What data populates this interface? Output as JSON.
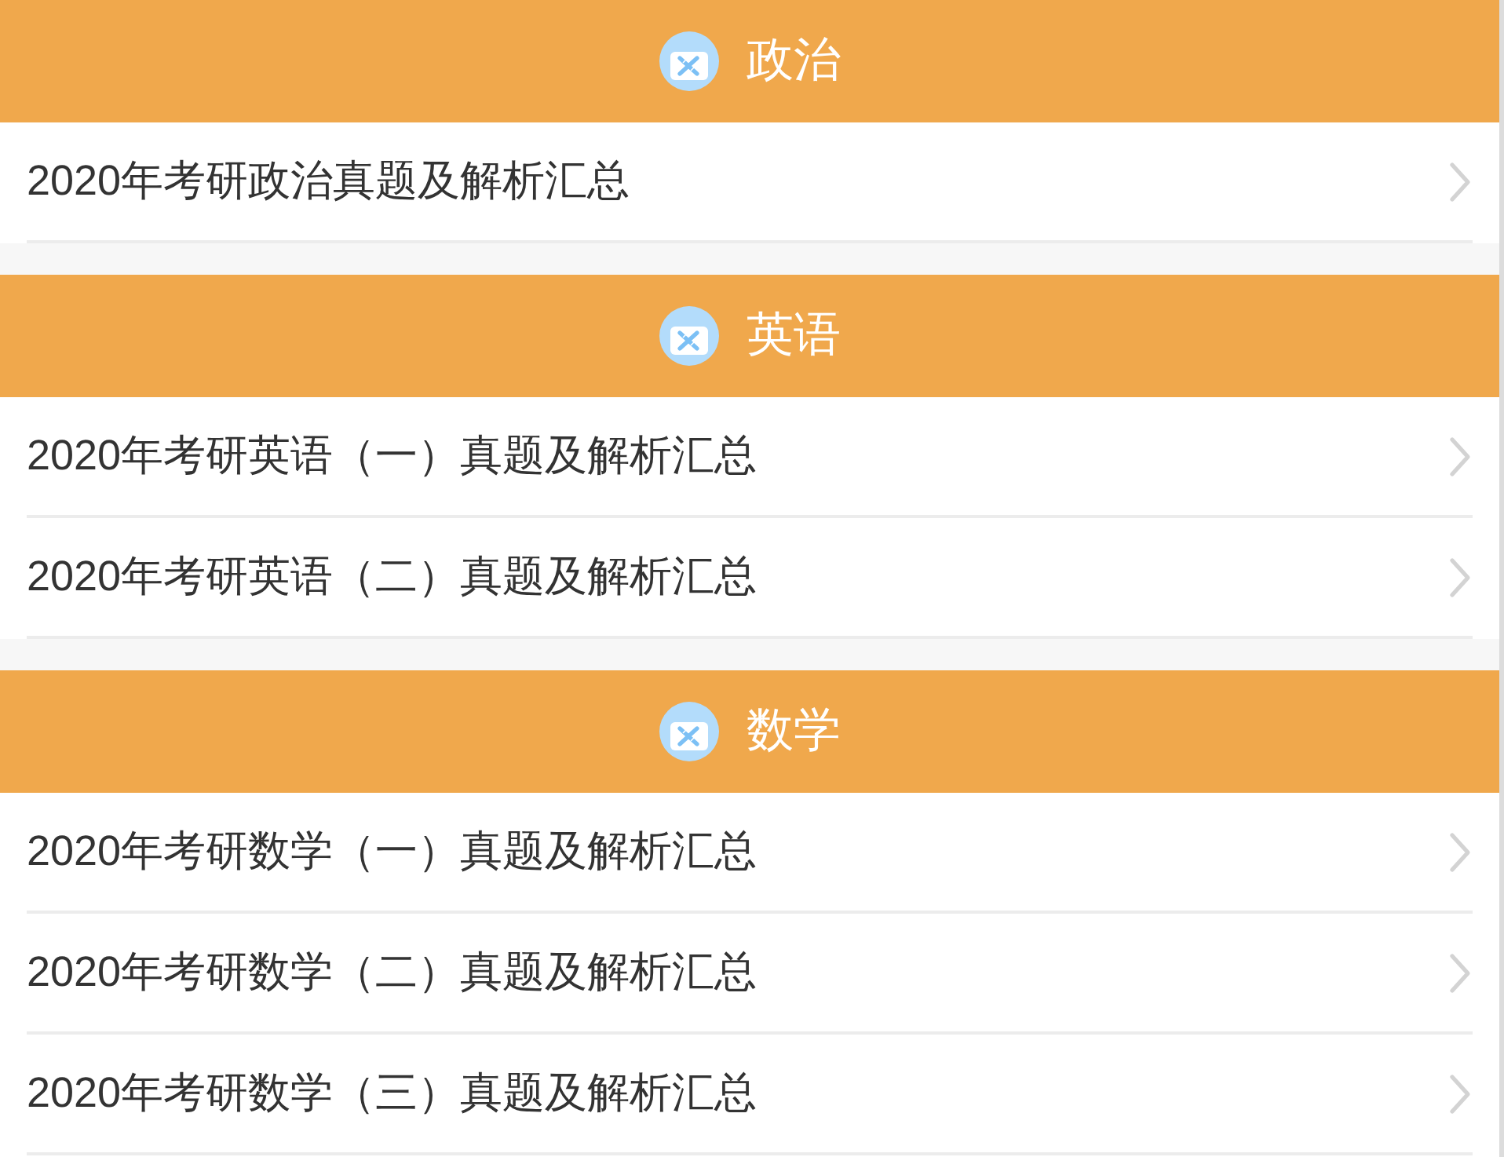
{
  "sections": [
    {
      "title": "政治",
      "items": [
        {
          "label": "2020年考研政治真题及解析汇总"
        }
      ]
    },
    {
      "title": "英语",
      "items": [
        {
          "label": "2020年考研英语（一）真题及解析汇总"
        },
        {
          "label": "2020年考研英语（二）真题及解析汇总"
        }
      ]
    },
    {
      "title": "数学",
      "items": [
        {
          "label": "2020年考研数学（一）真题及解析汇总"
        },
        {
          "label": "2020年考研数学（二）真题及解析汇总"
        },
        {
          "label": "2020年考研数学（三）真题及解析汇总"
        }
      ]
    }
  ]
}
